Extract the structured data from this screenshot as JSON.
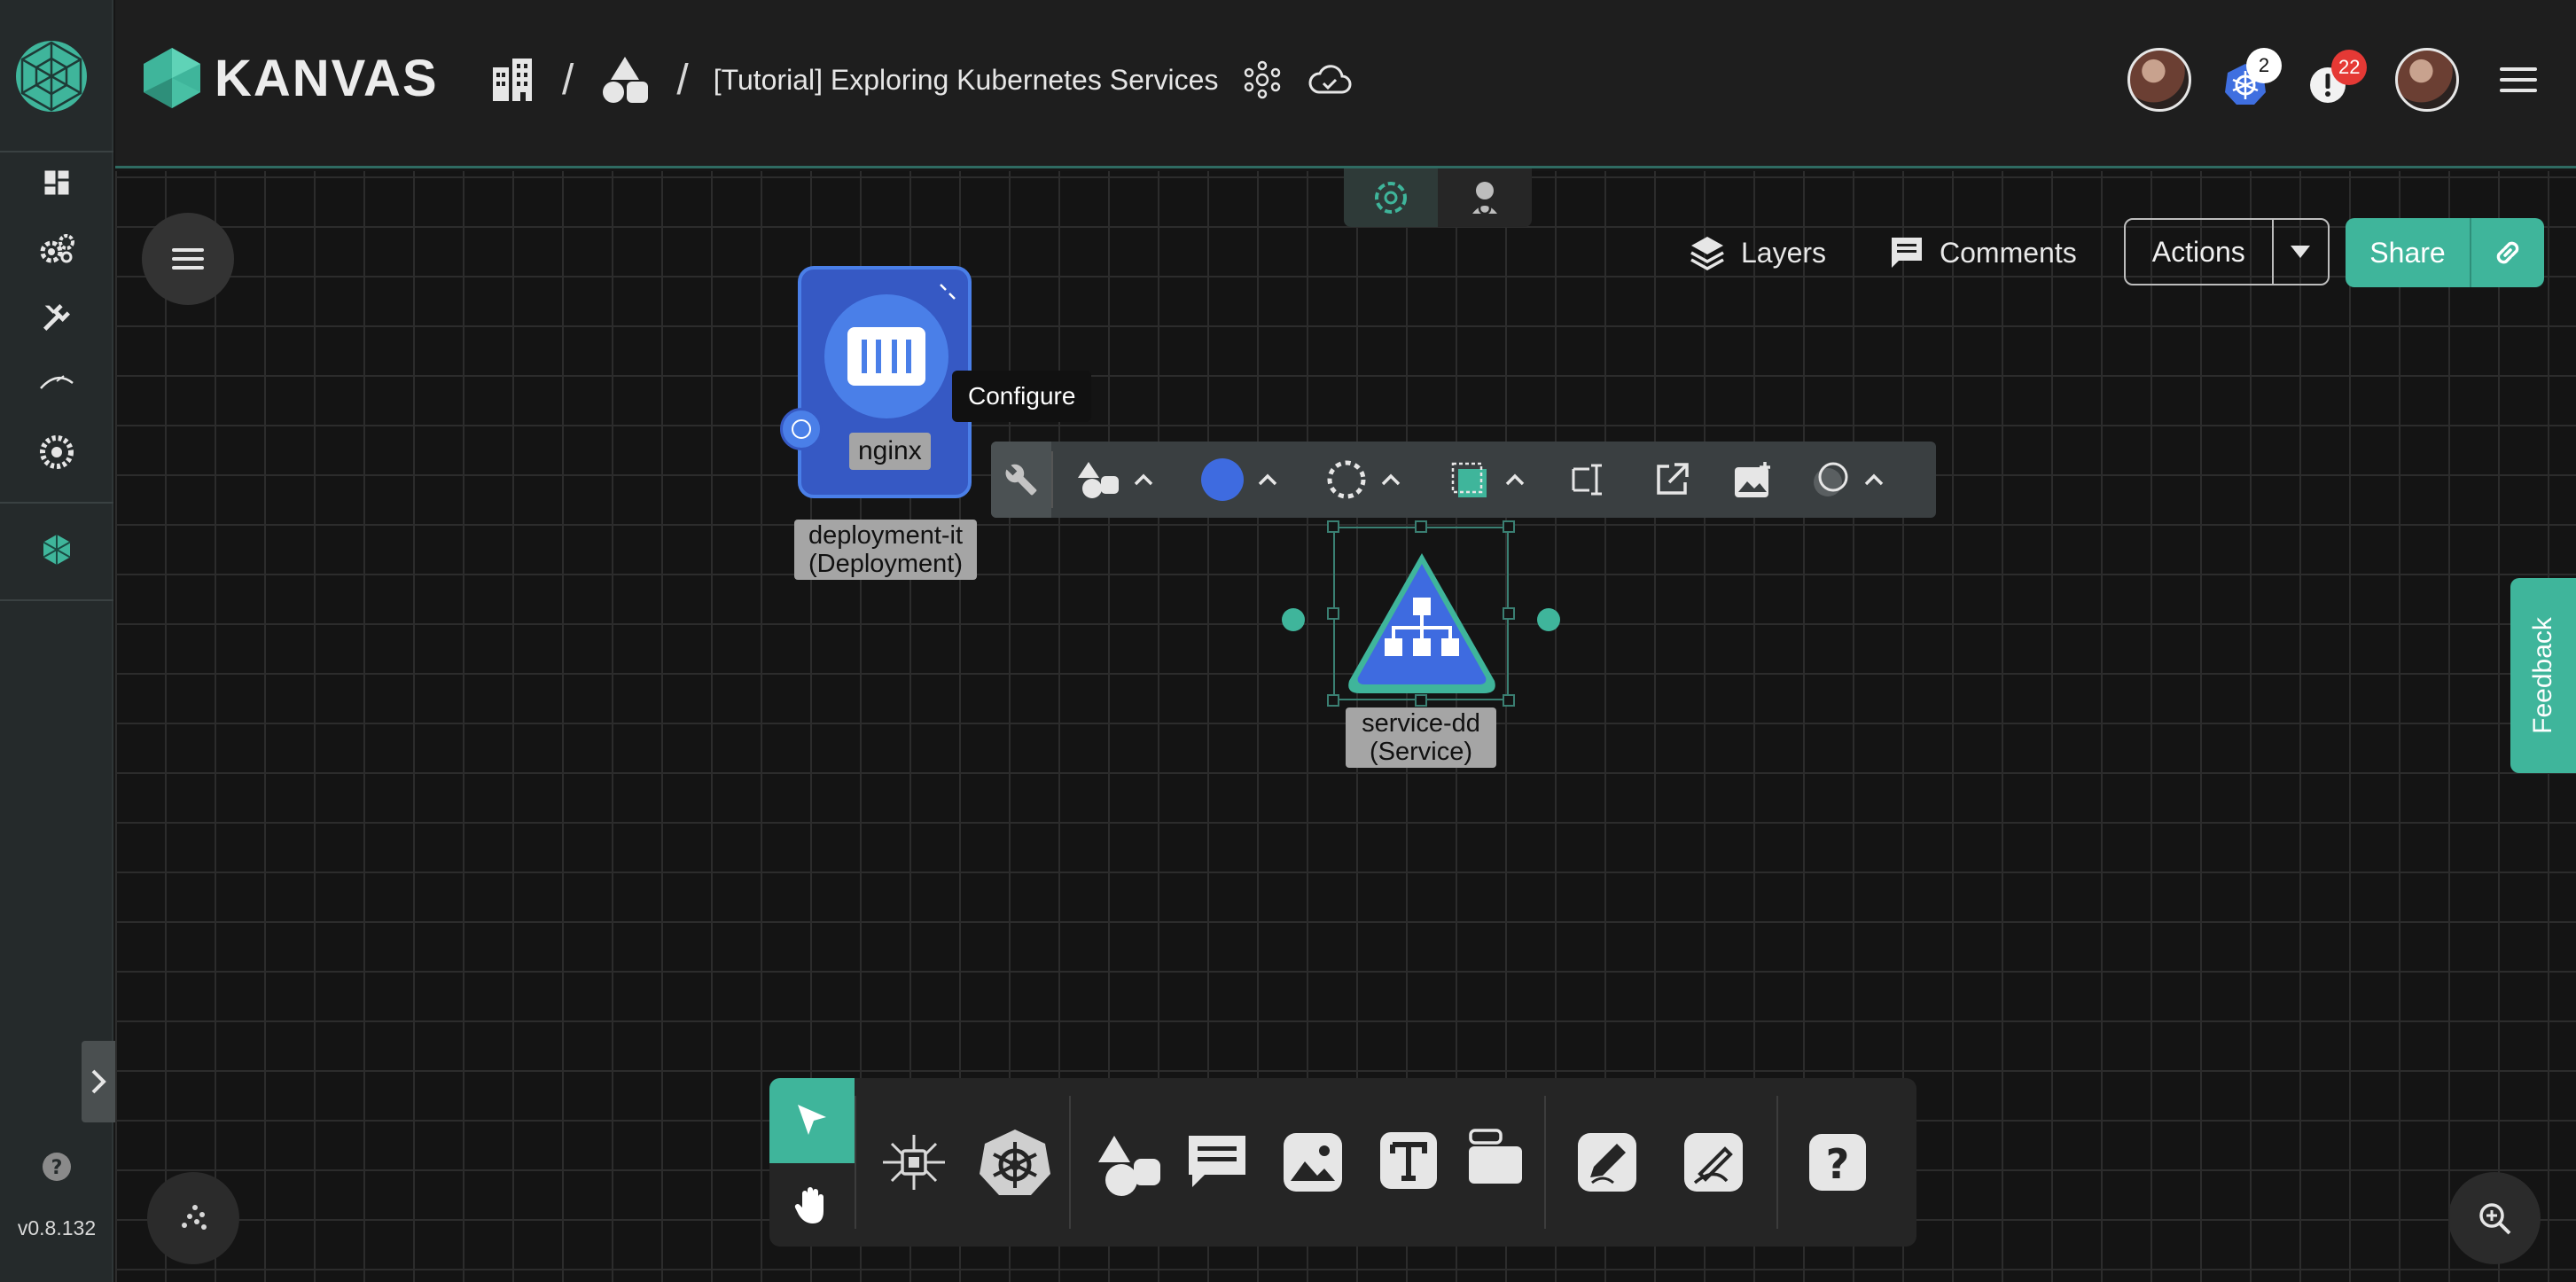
{
  "app": {
    "brand": "KANVAS",
    "version": "v0.8.132"
  },
  "header": {
    "breadcrumb_sep": "/",
    "design_title": "[Tutorial] Exploring Kubernetes Services",
    "k8s_badge": "2",
    "alerts_badge": "22"
  },
  "canvas_actions": {
    "layers": "Layers",
    "comments": "Comments",
    "actions": "Actions",
    "share": "Share"
  },
  "feedback": "Feedback",
  "tooltip": "Configure",
  "nodes": {
    "deployment": {
      "container_label": "nginx",
      "name": "deployment-it",
      "kind": "(Deployment)"
    },
    "service": {
      "name": "service-dd",
      "kind": "(Service)"
    }
  },
  "colors": {
    "accent": "#3fb59b",
    "node_blue": "#4a7fe8",
    "alert_red": "#e53935"
  }
}
